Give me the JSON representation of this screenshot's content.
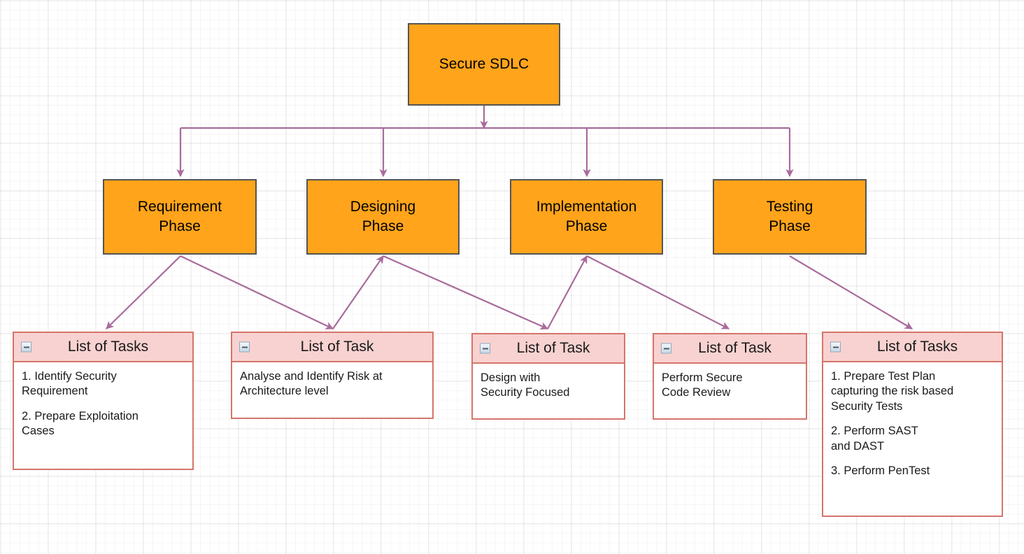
{
  "diagram": {
    "title": "Secure SDLC",
    "colors": {
      "node_fill": "#FFA41B",
      "node_border": "#555555",
      "task_header_fill": "#F8D2D0",
      "task_border": "#D4756B",
      "connector": "#A96B9B"
    },
    "root": {
      "label": "Secure SDLC"
    },
    "phases": [
      {
        "label": "Requirement\nPhase"
      },
      {
        "label": "Designing\nPhase"
      },
      {
        "label": "Implementation\nPhase"
      },
      {
        "label": "Testing\nPhase"
      }
    ],
    "tasks": [
      {
        "header": "List of Tasks",
        "icon": "collapse-minus-icon",
        "lines": [
          "1. Identify Security\nRequirement",
          "2. Prepare Exploitation\nCases"
        ]
      },
      {
        "header": "List of Task",
        "icon": "collapse-minus-icon",
        "lines": [
          "Analyse and Identify Risk at\nArchitecture level"
        ]
      },
      {
        "header": "List of Task",
        "icon": "collapse-minus-icon",
        "lines": [
          "Design with\nSecurity Focused"
        ]
      },
      {
        "header": "List of Task",
        "icon": "collapse-minus-icon",
        "lines": [
          "Perform Secure\nCode Review"
        ]
      },
      {
        "header": "List of Tasks",
        "icon": "collapse-minus-icon",
        "lines": [
          "1. Prepare Test Plan\ncapturing the risk based\nSecurity Tests",
          "2. Perform SAST\nand DAST",
          "3. Perform PenTest"
        ]
      }
    ]
  }
}
